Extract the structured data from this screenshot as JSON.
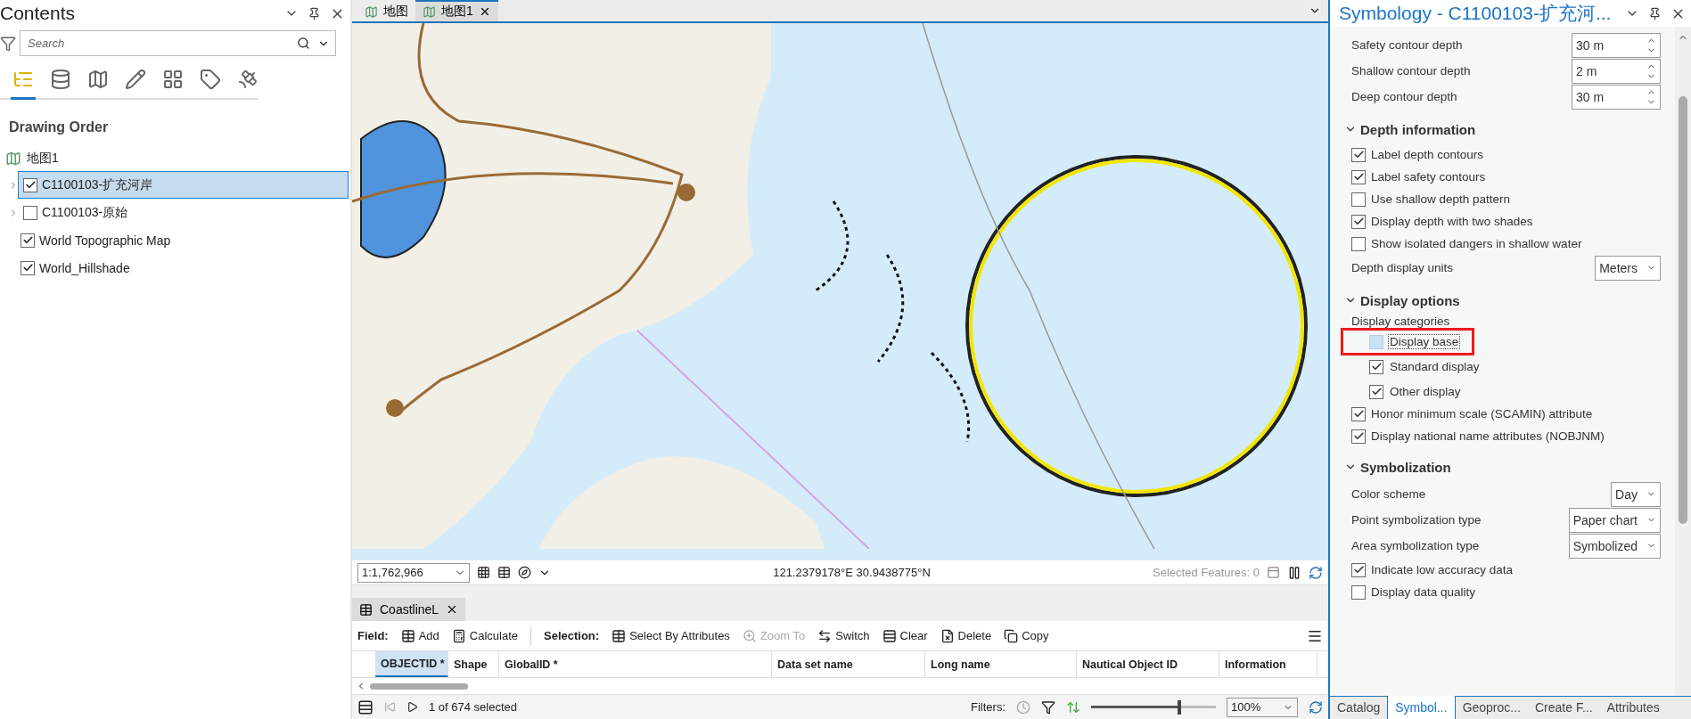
{
  "contents": {
    "title": "Contents",
    "search": {
      "placeholder": "Search"
    },
    "tools": [
      {
        "kind": "order",
        "selected": true
      },
      {
        "kind": "source",
        "selected": false
      },
      {
        "kind": "selection",
        "selected": false
      },
      {
        "kind": "editing",
        "selected": false
      },
      {
        "kind": "snapping",
        "selected": false
      },
      {
        "kind": "labeling",
        "selected": false
      },
      {
        "kind": "perspective",
        "selected": false
      }
    ],
    "heading": "Drawing Order",
    "tree": [
      {
        "label": "地图1",
        "children": [
          {
            "label": "C1100103-扩充河岸",
            "checked": true,
            "selected": true,
            "expandable": true
          },
          {
            "label": "C1100103-原始",
            "checked": false,
            "selected": false,
            "expandable": true
          },
          {
            "label": "World Topographic Map",
            "checked": true,
            "selected": false,
            "expandable": false
          },
          {
            "label": "World_Hillshade",
            "checked": true,
            "selected": false,
            "expandable": false
          }
        ]
      }
    ]
  },
  "map_tabs": [
    {
      "label": "地图",
      "selected": false
    },
    {
      "label": "地图1",
      "selected": true
    }
  ],
  "map_status": {
    "scale": "1:1,762,966",
    "coordinates": "121.2379178°E 30.9438775°N",
    "selected_features": "Selected Features: 0"
  },
  "table": {
    "tab": "CoastlineL",
    "field_label": "Field:",
    "field_actions": [
      {
        "label": "Add",
        "kind": "add",
        "disabled": false
      },
      {
        "label": "Calculate",
        "kind": "calculate",
        "disabled": false
      }
    ],
    "selection_label": "Selection:",
    "selection_actions": [
      {
        "label": "Select By Attributes",
        "kind": "select",
        "disabled": false
      },
      {
        "label": "Zoom To",
        "kind": "zoom",
        "disabled": true
      },
      {
        "label": "Switch",
        "kind": "switch",
        "disabled": false
      },
      {
        "label": "Clear",
        "kind": "clear",
        "disabled": false
      },
      {
        "label": "Delete",
        "kind": "delete",
        "disabled": false
      },
      {
        "label": "Copy",
        "kind": "copy",
        "disabled": false
      }
    ],
    "columns": [
      {
        "label": "OBJECTID *",
        "selected": true
      },
      {
        "label": "Shape",
        "selected": false
      },
      {
        "label": "GlobalID *",
        "selected": false
      },
      {
        "label": "Data set name",
        "selected": false
      },
      {
        "label": "Long name",
        "selected": false
      },
      {
        "label": "Nautical Object ID",
        "selected": false
      },
      {
        "label": "Information",
        "selected": false
      }
    ],
    "count": "1 of 674 selected",
    "filters_label": "Filters:",
    "zoom": {
      "level": 0.72
    },
    "zoom_value": "100%"
  },
  "symbology": {
    "title": "Symbology - C1100103-扩充河...",
    "sections": [
      {
        "items": [
          {
            "kind": "number",
            "label": "Safety contour depth",
            "value": "30 m"
          },
          {
            "kind": "number",
            "label": "Shallow contour depth",
            "value": "2 m"
          },
          {
            "kind": "number",
            "label": "Deep contour depth",
            "value": "30 m"
          }
        ]
      },
      {
        "heading": "Depth information",
        "expanded": true,
        "items": [
          {
            "kind": "checkbox",
            "label": "Label depth contours",
            "checked": true
          },
          {
            "kind": "checkbox",
            "label": "Label safety contours",
            "checked": true
          },
          {
            "kind": "checkbox",
            "label": "Use shallow depth pattern",
            "checked": false
          },
          {
            "kind": "checkbox",
            "label": "Display depth with two shades",
            "checked": true
          },
          {
            "kind": "checkbox",
            "label": "Show isolated dangers in shallow water",
            "checked": false
          },
          {
            "kind": "dropdown",
            "label": "Depth display units",
            "value": "Meters"
          }
        ]
      },
      {
        "heading": "Display options",
        "expanded": true,
        "items": [
          {
            "kind": "group",
            "label": "Display categories",
            "children": [
              {
                "label": "Display base",
                "checked": false,
                "focused": true,
                "annotated": true
              },
              {
                "label": "Standard display",
                "checked": true,
                "focused": false,
                "annotated": false
              },
              {
                "label": "Other display",
                "checked": true,
                "focused": false,
                "annotated": false
              }
            ]
          },
          {
            "kind": "checkbox",
            "label": "Honor minimum scale (SCAMIN) attribute",
            "checked": true
          },
          {
            "kind": "checkbox",
            "label": "Display national name attributes (NOBJNM)",
            "checked": true
          }
        ]
      },
      {
        "heading": "Symbolization",
        "expanded": true,
        "items": [
          {
            "kind": "dropdown",
            "label": "Color scheme",
            "value": "Day"
          },
          {
            "kind": "dropdown",
            "label": "Point symbolization type",
            "value": "Paper chart"
          },
          {
            "kind": "dropdown",
            "label": "Area symbolization type",
            "value": "Symbolized"
          },
          {
            "kind": "checkbox",
            "label": "Indicate low accuracy data",
            "checked": true
          },
          {
            "kind": "checkbox",
            "label": "Display data quality",
            "checked": false
          }
        ]
      }
    ]
  },
  "bottom_tabs": [
    {
      "label": "Catalog",
      "selected": false
    },
    {
      "label": "Symbol...",
      "selected": true
    },
    {
      "label": "Geoproc...",
      "selected": false
    },
    {
      "label": "Create F...",
      "selected": false
    },
    {
      "label": "Attributes",
      "selected": false
    }
  ]
}
